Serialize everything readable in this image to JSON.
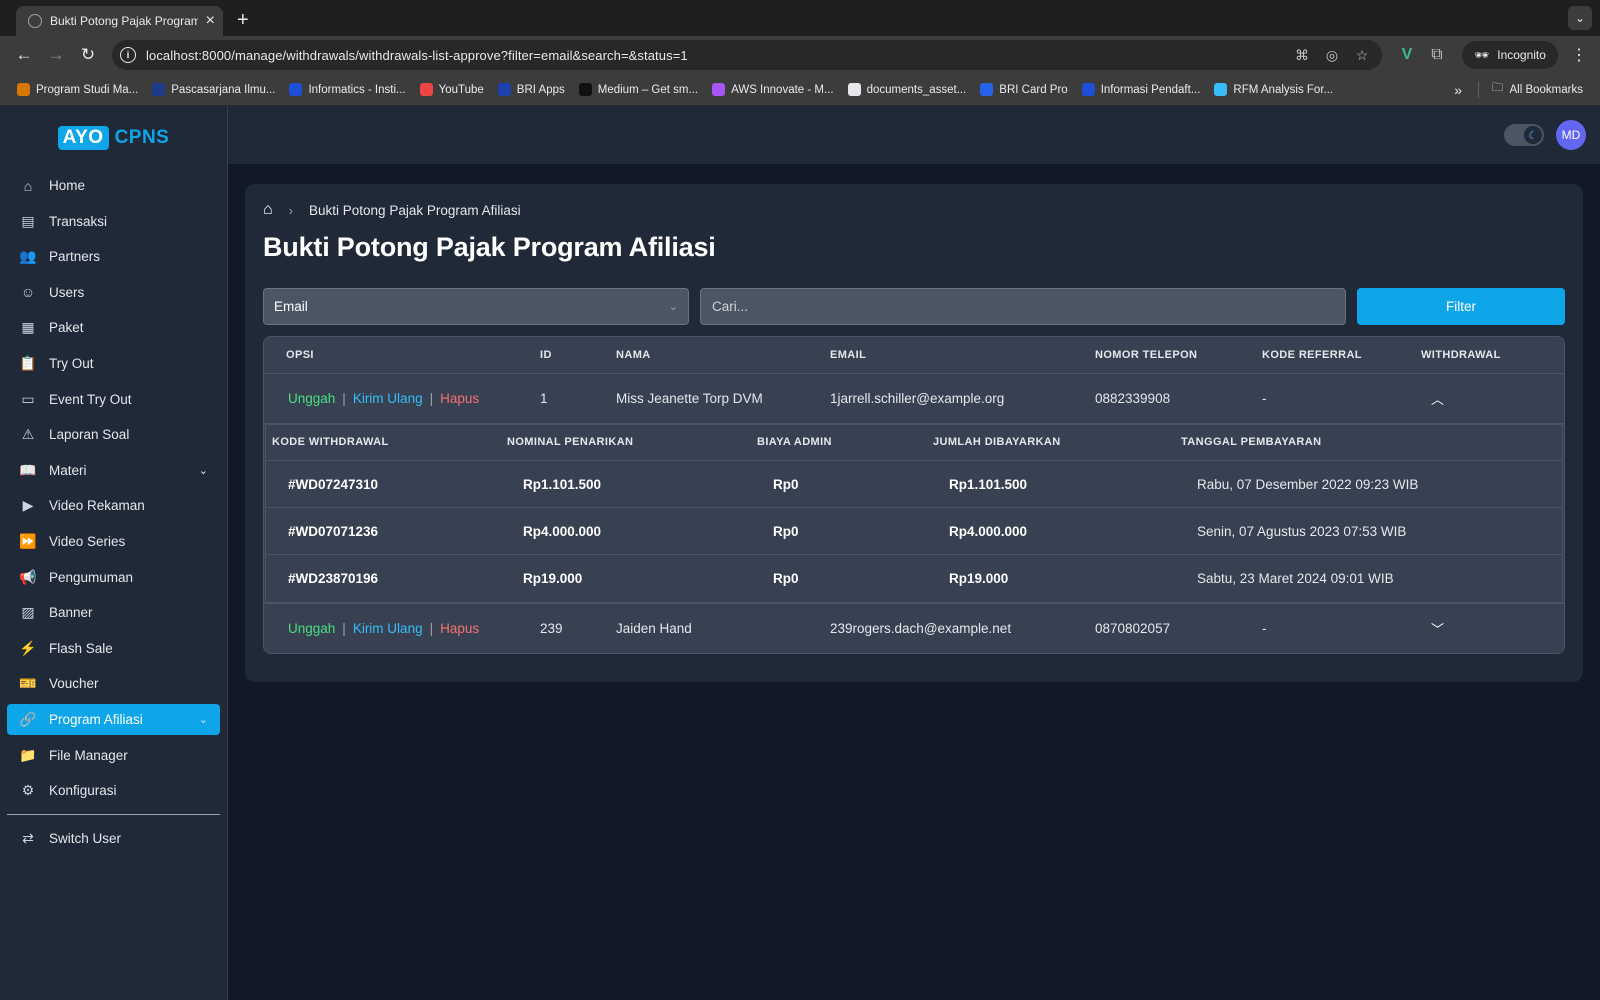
{
  "browser": {
    "tab_title": "Bukti Potong Pajak Program Afiliasi",
    "url": "localhost:8000/manage/withdrawals/withdrawals-list-approve?filter=email&search=&status=1",
    "incognito_label": "Incognito",
    "bookmarks": [
      {
        "label": "Program Studi Ma...",
        "color": "#d97706"
      },
      {
        "label": "Pascasarjana Ilmu...",
        "color": "#1e3a8a"
      },
      {
        "label": "Informatics - Insti...",
        "color": "#1d4ed8"
      },
      {
        "label": "YouTube",
        "color": "#ef4444"
      },
      {
        "label": "BRI Apps",
        "color": "#1e40af"
      },
      {
        "label": "Medium – Get sm...",
        "color": "#111111"
      },
      {
        "label": "AWS Innovate - M...",
        "color": "#a855f7"
      },
      {
        "label": "documents_asset...",
        "color": "#e5e7eb"
      },
      {
        "label": "BRI Card Pro",
        "color": "#2563eb"
      },
      {
        "label": "Informasi Pendaft...",
        "color": "#1d4ed8"
      },
      {
        "label": "RFM Analysis For...",
        "color": "#38bdf8"
      }
    ],
    "all_bookmarks_label": "All Bookmarks"
  },
  "sidebar": {
    "logo_ayo": "AYO",
    "logo_cpns": "CPNS",
    "items": [
      {
        "label": "Home",
        "icon": "⌂",
        "name": "home"
      },
      {
        "label": "Transaksi",
        "icon": "▤",
        "name": "transaksi"
      },
      {
        "label": "Partners",
        "icon": "👥",
        "name": "partners"
      },
      {
        "label": "Users",
        "icon": "☺",
        "name": "users"
      },
      {
        "label": "Paket",
        "icon": "▦",
        "name": "paket"
      },
      {
        "label": "Try Out",
        "icon": "📋",
        "name": "try-out"
      },
      {
        "label": "Event Try Out",
        "icon": "▭",
        "name": "event-try-out"
      },
      {
        "label": "Laporan Soal",
        "icon": "⚠",
        "name": "laporan-soal"
      },
      {
        "label": "Materi",
        "icon": "📖",
        "name": "materi",
        "chevron": true
      },
      {
        "label": "Video Rekaman",
        "icon": "▶",
        "name": "video-rekaman"
      },
      {
        "label": "Video Series",
        "icon": "⏩",
        "name": "video-series"
      },
      {
        "label": "Pengumuman",
        "icon": "📢",
        "name": "pengumuman"
      },
      {
        "label": "Banner",
        "icon": "▨",
        "name": "banner"
      },
      {
        "label": "Flash Sale",
        "icon": "⚡",
        "name": "flash-sale"
      },
      {
        "label": "Voucher",
        "icon": "🎫",
        "name": "voucher"
      },
      {
        "label": "Program Afiliasi",
        "icon": "🔗",
        "name": "program-afiliasi",
        "chevron": true,
        "active": true
      },
      {
        "label": "File Manager",
        "icon": "📁",
        "name": "file-manager"
      },
      {
        "label": "Konfigurasi",
        "icon": "⚙",
        "name": "konfigurasi"
      }
    ],
    "switch_user": {
      "label": "Switch User",
      "icon": "⇄"
    }
  },
  "topbar": {
    "avatar_initials": "MD",
    "theme": "dark"
  },
  "page": {
    "breadcrumb_current": "Bukti Potong Pajak Program Afiliasi",
    "title": "Bukti Potong Pajak Program Afiliasi",
    "filter_select_value": "Email",
    "search_placeholder": "Cari...",
    "filter_button": "Filter"
  },
  "table": {
    "headers": [
      "OPSI",
      "ID",
      "NAMA",
      "EMAIL",
      "NOMOR TELEPON",
      "KODE REFERRAL",
      "WITHDRAWAL"
    ],
    "actions": {
      "unggah": "Unggah",
      "kirim": "Kirim Ulang",
      "hapus": "Hapus"
    },
    "rows": [
      {
        "id": "1",
        "nama": "Miss Jeanette Torp DVM",
        "email": "1jarrell.schiller@example.org",
        "telepon": "0882339908",
        "referral": "-",
        "expanded": true
      },
      {
        "id": "239",
        "nama": "Jaiden Hand",
        "email": "239rogers.dach@example.net",
        "telepon": "0870802057",
        "referral": "-",
        "expanded": false
      }
    ],
    "sub_headers": [
      "KODE WITHDRAWAL",
      "NOMINAL PENARIKAN",
      "BIAYA ADMIN",
      "JUMLAH DIBAYARKAN",
      "TANGGAL PEMBAYARAN"
    ],
    "sub_rows": [
      {
        "kode": "#WD07247310",
        "nominal": "Rp1.101.500",
        "admin": "Rp0",
        "jumlah": "Rp1.101.500",
        "tanggal": "Rabu, 07 Desember 2022 09:23 WIB"
      },
      {
        "kode": "#WD07071236",
        "nominal": "Rp4.000.000",
        "admin": "Rp0",
        "jumlah": "Rp4.000.000",
        "tanggal": "Senin, 07 Agustus 2023 07:53 WIB"
      },
      {
        "kode": "#WD23870196",
        "nominal": "Rp19.000",
        "admin": "Rp0",
        "jumlah": "Rp19.000",
        "tanggal": "Sabtu, 23 Maret 2024 09:01 WIB"
      }
    ]
  },
  "colors": {
    "accent": "#0ea5e9",
    "unggah": "#4ade80",
    "kirim": "#38bdf8",
    "hapus": "#f87171"
  }
}
